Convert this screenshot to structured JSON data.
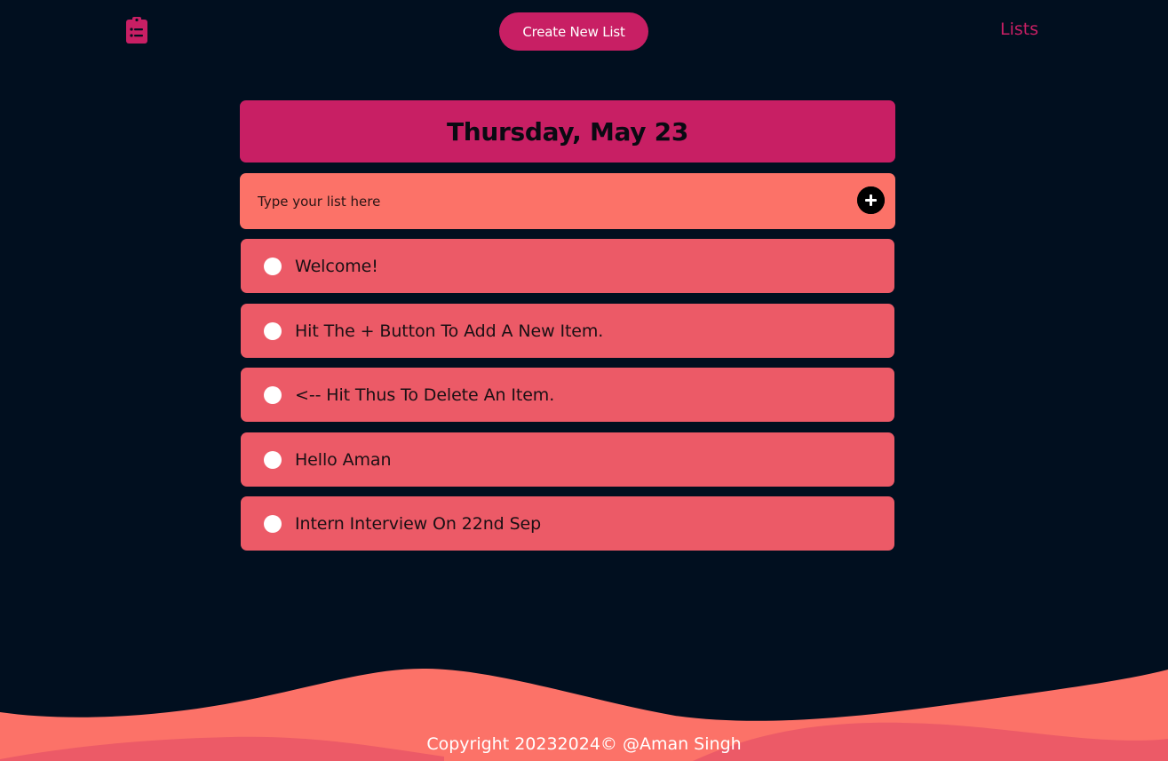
{
  "header": {
    "logo_icon": "clipboard-list-icon",
    "create_button_label": "Create New List",
    "nav_lists_label": "Lists"
  },
  "main": {
    "date_title": "Thursday, May 23",
    "input": {
      "placeholder": "Type your list here",
      "value": ""
    },
    "add_icon": "plus-circle-icon",
    "items": [
      {
        "label": "Welcome!"
      },
      {
        "label": "Hit The + Button To Add A New Item."
      },
      {
        "label": "<-- Hit Thus To Delete An Item."
      },
      {
        "label": "Hello Aman"
      },
      {
        "label": "Intern Interview On 22nd Sep"
      }
    ]
  },
  "footer": {
    "copyright": "Copyright 20232024© @Aman Singh"
  },
  "colors": {
    "background": "#010f1f",
    "accent": "#c81f64",
    "input_bg": "#fc7268",
    "item_bg": "#ec5a67",
    "wave_front": "#fc7268",
    "wave_back": "#ec5a67"
  }
}
